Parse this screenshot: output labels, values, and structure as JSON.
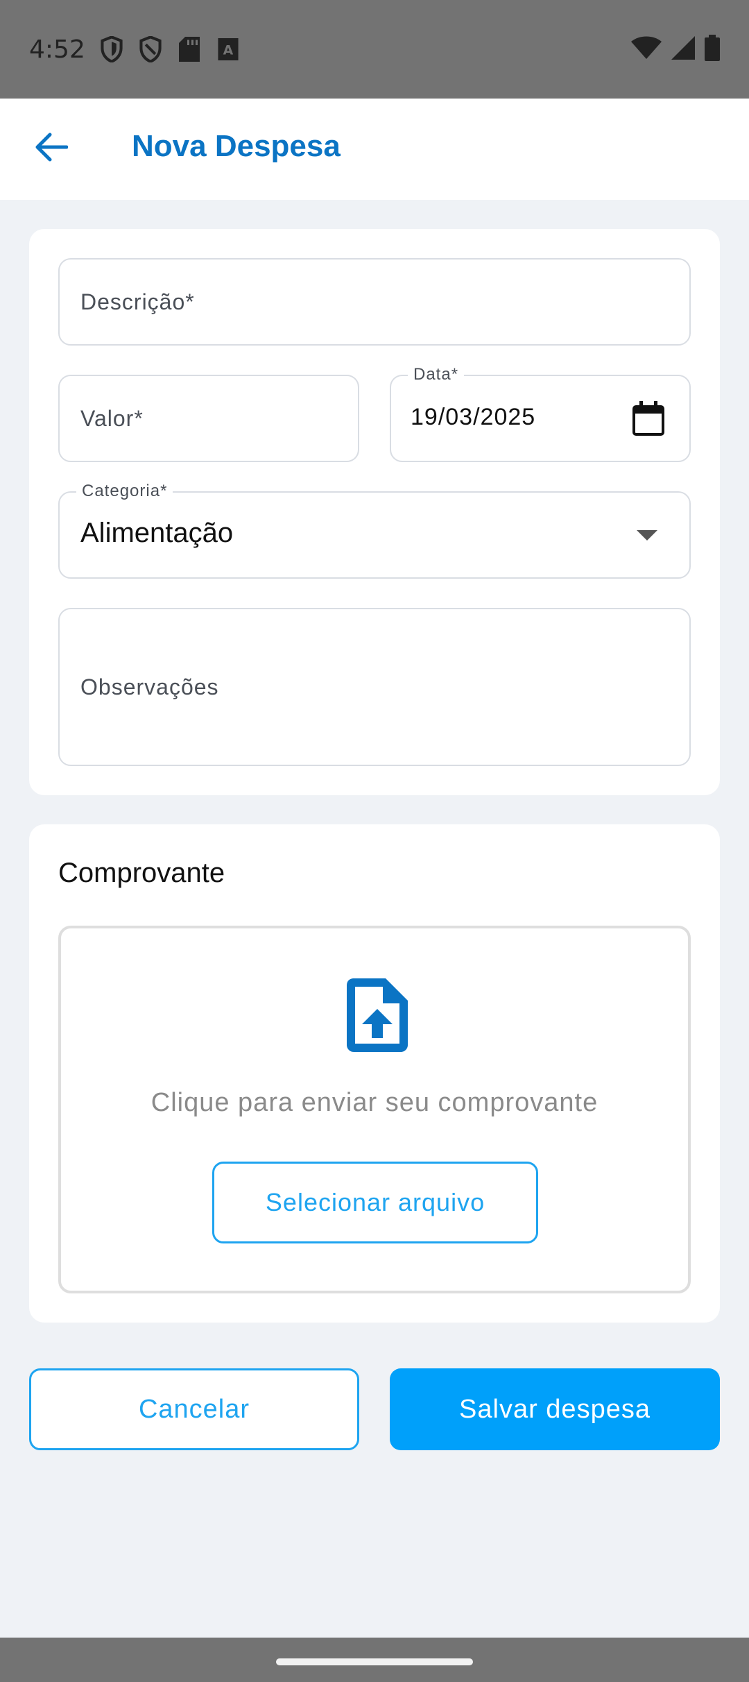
{
  "status_bar": {
    "time": "4:52",
    "left_icons": [
      "shield-icon",
      "shield-outline-icon",
      "sd-card-icon",
      "keyboard-a-icon"
    ],
    "right_icons": [
      "wifi-icon",
      "signal-icon",
      "battery-icon"
    ]
  },
  "app_bar": {
    "title": "Nova Despesa",
    "back_icon": "arrow-back-icon",
    "accent_color": "#0b74c4"
  },
  "form": {
    "description": {
      "placeholder": "Descrição*",
      "value": ""
    },
    "amount": {
      "placeholder": "Valor*",
      "value": ""
    },
    "date": {
      "label": "Data*",
      "value": "19/03/2025",
      "icon": "calendar-icon"
    },
    "category": {
      "label": "Categoria*",
      "value": "Alimentação",
      "icon": "dropdown-arrow-icon"
    },
    "notes": {
      "placeholder": "Observações",
      "value": ""
    }
  },
  "receipt": {
    "title": "Comprovante",
    "icon": "file-upload-icon",
    "prompt": "Clique para enviar seu comprovante",
    "select_button": "Selecionar arquivo"
  },
  "actions": {
    "cancel": "Cancelar",
    "save": "Salvar despesa",
    "primary_color": "#00a0fa"
  }
}
